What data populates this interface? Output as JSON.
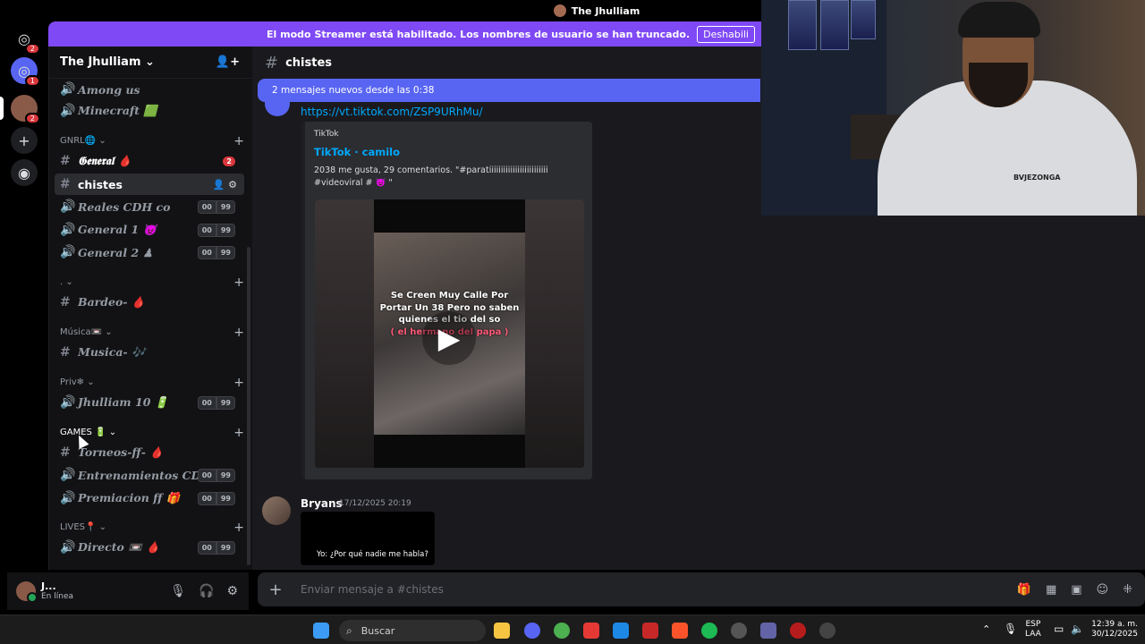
{
  "titlebar": {
    "title": "The Jhulliam"
  },
  "streamer_bar": {
    "text": "El modo Streamer está habilitado. Los nombres de usuario se han truncado.",
    "button": "Deshabili"
  },
  "rail": {
    "dm_badge": "2",
    "server_badge": "1",
    "server2_badge": "2",
    "add_icon": "+",
    "explore_icon": "◉"
  },
  "server": {
    "name": "The Jhulliam",
    "chevron": "⌄",
    "invite_icon": "person-add"
  },
  "channels": {
    "voice_among": "Among us",
    "voice_minecraft": "Minecraft 🟩",
    "cat_gnrl": "GNRL🌐 ⌄",
    "general": "𝕲𝖊𝖓𝖊𝖗𝖆𝖑 🩸",
    "general_badge": "2",
    "chistes": "chistes",
    "reales": "Reales CDH co",
    "general1": "General 1 👿",
    "general2": "General 2 ♟",
    "cat_dot": ". ⌄",
    "bardeo": "Bardeo- 🩸",
    "cat_musica": "Música📼 ⌄",
    "musica": "Musica- 🎶",
    "cat_priv": "Priv❄ ⌄",
    "jhulliam": "Jhulliam 10 🔋",
    "cat_games": "GAMES 🔋 ⌄",
    "torneos": "Torneos-ff- 🩸",
    "entrenamientos": "Entrenamientos CD...",
    "premiacion": "Premiacion ff 🎁",
    "cat_lives": "LIVES📍 ⌄",
    "directo": "Directo 📼 🩸",
    "count_a": "00",
    "count_b": "99",
    "plus": "+"
  },
  "user": {
    "name": "J...",
    "status": "En línea"
  },
  "chat": {
    "channel": "chistes",
    "new_messages": "2 mensajes nuevos desde las 0:38",
    "link": "https://vt.tiktok.com/ZSP9URhMu/",
    "embed_provider": "TikTok",
    "embed_title": "TikTok · camilo",
    "embed_desc": "2038 me gusta, 29 comentarios. \"#paratiiiiiiiiiiiiiiiiiiiiiiiii #videoviral # 👿 \"",
    "video_caption": "Se Creen Muy Calle Por Portar Un 38 Pero no saben quienes el tio del so",
    "video_caption2": "( el hermano del papa )",
    "author": "Bryans",
    "timestamp": "17/12/2025 20:19",
    "attachment_text": "Yo: ¿Por qué nadie me habla?",
    "placeholder": "Enviar mensaje a #chistes"
  },
  "webcam": {
    "shirt_text": "BVJEZONGA"
  },
  "taskbar": {
    "search": "Buscar",
    "lang1": "ESP",
    "lang2": "LAA",
    "time": "12:39 a. m.",
    "date": "30/12/2025"
  }
}
